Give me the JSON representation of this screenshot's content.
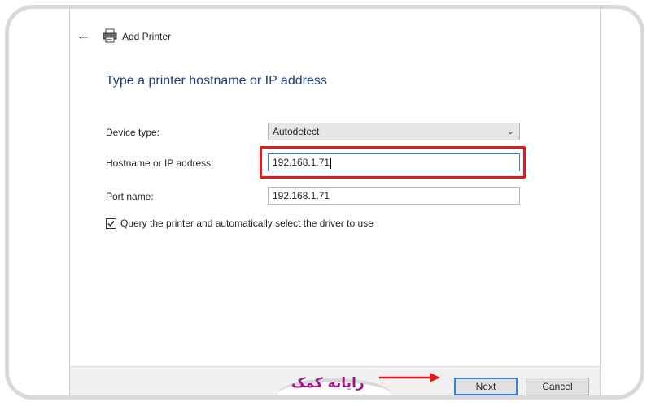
{
  "window": {
    "title": "Add Printer"
  },
  "heading": "Type a printer hostname or IP address",
  "form": {
    "device_type_label": "Device type:",
    "device_type_value": "Autodetect",
    "hostname_label": "Hostname or IP address:",
    "hostname_value": "192.168.1.71",
    "port_label": "Port name:",
    "port_value": "192.168.1.71",
    "query_label": "Query the printer and automatically select the driver to use",
    "query_checked": true
  },
  "buttons": {
    "next": "Next",
    "cancel": "Cancel"
  },
  "watermark": {
    "logo_text": "رایانه کمک"
  },
  "colors": {
    "heading": "#1f3f7a",
    "highlight": "#e0191c",
    "logo": "#a3178c",
    "primary_button_border": "#3c7fd6"
  },
  "icons": {
    "back": "back-arrow-icon",
    "printer": "printer-icon",
    "dropdown": "chevron-down-icon",
    "check": "checkmark-icon",
    "annotation_arrow": "red-arrow-icon"
  }
}
